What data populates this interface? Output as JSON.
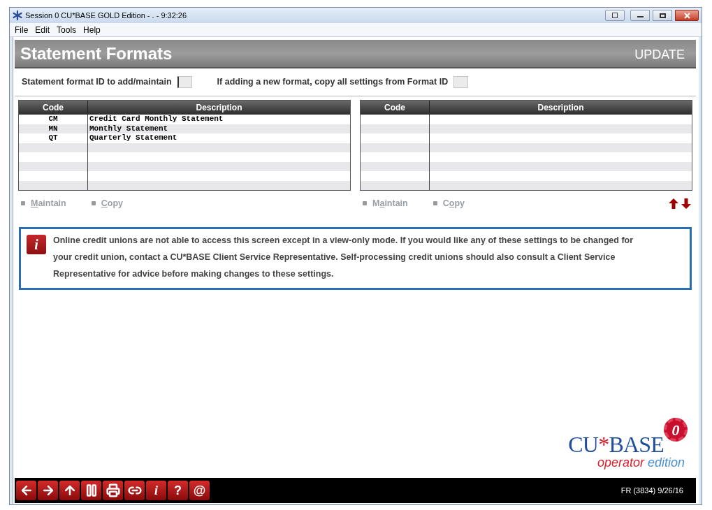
{
  "window": {
    "title": "Session 0 CU*BASE GOLD Edition - . - 9:32:26"
  },
  "menu": [
    "File",
    "Edit",
    "Tools",
    "Help"
  ],
  "header": {
    "title": "Statement Formats",
    "mode": "UPDATE"
  },
  "fields": [
    {
      "label": "Statement format ID to add/maintain",
      "focused": true
    },
    {
      "label": "If adding a new format, copy all settings from Format ID",
      "focused": false
    }
  ],
  "tables": [
    {
      "columns": [
        "Code",
        "Description"
      ],
      "rows": [
        [
          "CM",
          "Credit Card Monthly Statement"
        ],
        [
          "MN",
          "Monthly Statement"
        ],
        [
          "QT",
          "Quarterly Statement"
        ]
      ],
      "actions": [
        {
          "key": "M",
          "after": "aintain",
          "disabled": true
        },
        {
          "key": "C",
          "after": "opy",
          "disabled": true
        }
      ]
    },
    {
      "columns": [
        "Code",
        "Description"
      ],
      "actions": [
        {
          "before": "M",
          "key": "a",
          "after": "intain",
          "disabled": true
        },
        {
          "before": "C",
          "key": "o",
          "after": "py",
          "disabled": true
        }
      ]
    }
  ],
  "info": {
    "badge": "i",
    "text": "Online credit unions are not able to access this screen except in a view-only mode. If you would like any of these settings to be changed for your credit union, contact a CU*BASE Client Service Representative. Self-processing credit unions should also consult a Client Service Representative for advice before making changes to these settings."
  },
  "logo": {
    "badge": "0",
    "name": "CU",
    "star": "*",
    "name2": "BASE",
    "edition1": "operator",
    "edition2": " edition"
  },
  "toolbar": [
    {
      "kind": "icon"
    },
    {
      "kind": "icon"
    },
    {
      "kind": "icon"
    },
    {
      "kind": "icon"
    },
    {
      "kind": "icon"
    },
    {
      "kind": "icon"
    },
    {
      "kind": "char",
      "label": "i"
    },
    {
      "kind": "char",
      "label": "?"
    },
    {
      "kind": "char",
      "label": "@"
    }
  ],
  "status": "FR (3834) 9/26/16"
}
